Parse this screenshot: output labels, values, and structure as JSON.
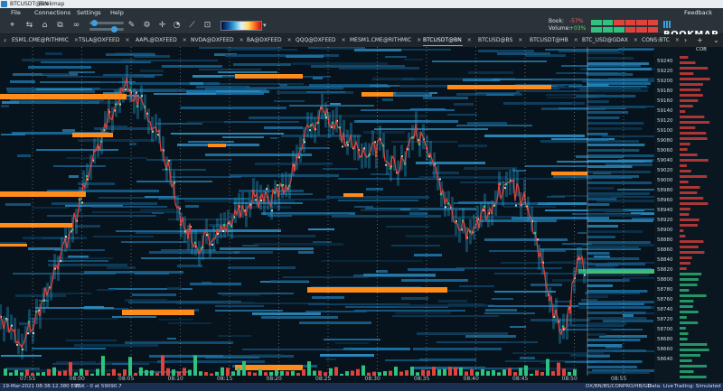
{
  "window": {
    "title": "BTCUSDT@BN",
    "app_name": "Bookmap"
  },
  "menu": [
    "File",
    "Connections",
    "Settings",
    "Help"
  ],
  "feedback_label": "Feedback",
  "book": {
    "label": "Book:",
    "value": "-57%"
  },
  "volume": {
    "label": "Volume:",
    "value": "+03%"
  },
  "logo_text": "BOOKMAP",
  "tabs": [
    "ESM1.CME@RITHMIC",
    "TSLA@DXFEED",
    "AAPL@DXFEED",
    "NVDA@DXFEED",
    "BA@DXFEED",
    "QQQ@DXFEED",
    "MESM1.CME@RITHMIC",
    "BTCUSDT@BN",
    "BTCUSD@BS",
    "BTCUSDT@HB",
    "BTC_USD@GDAX",
    "CONS:BTC"
  ],
  "active_tab": "BTCUSDT@BN",
  "cob_label": "COB",
  "price_levels": [
    59240,
    59220,
    59200,
    59180,
    59160,
    59140,
    59120,
    59100,
    59080,
    59060,
    59040,
    59020,
    59000,
    58980,
    58960,
    58940,
    58920,
    58900,
    58880,
    58860,
    58840,
    58820,
    58800,
    58780,
    58760,
    58740,
    58720,
    58700,
    58680,
    58660,
    58640
  ],
  "current_price": "58880",
  "time_labels": [
    "07:55",
    "08:00",
    "08:05",
    "08:10",
    "08:15",
    "08:20",
    "08:25",
    "08:30",
    "08:35",
    "08:40",
    "08:45",
    "08:50",
    "08:55"
  ],
  "status": {
    "datetime": "19-Mar-2021 08:38:12.380 EST",
    "ask": "ASK - 0 at 59090.7",
    "feeds": "DX/BN/BS/CONPRO/HB/GD",
    "data_live": "Data: Live",
    "trading": "Trading: Simulated"
  },
  "icons": {
    "toolbar": [
      "crosshair-icon",
      "share-icon",
      "tag-icon",
      "link-icon",
      "pencil-icon",
      "settings-icon",
      "target-icon",
      "timer-icon",
      "chart-icon",
      "lock-icon"
    ]
  },
  "colors": {
    "accent": "#5ab4ee",
    "bid_ask_orange": "#ff8c1a",
    "up_trade": "#2ec27e",
    "down_trade": "#e0433c"
  }
}
